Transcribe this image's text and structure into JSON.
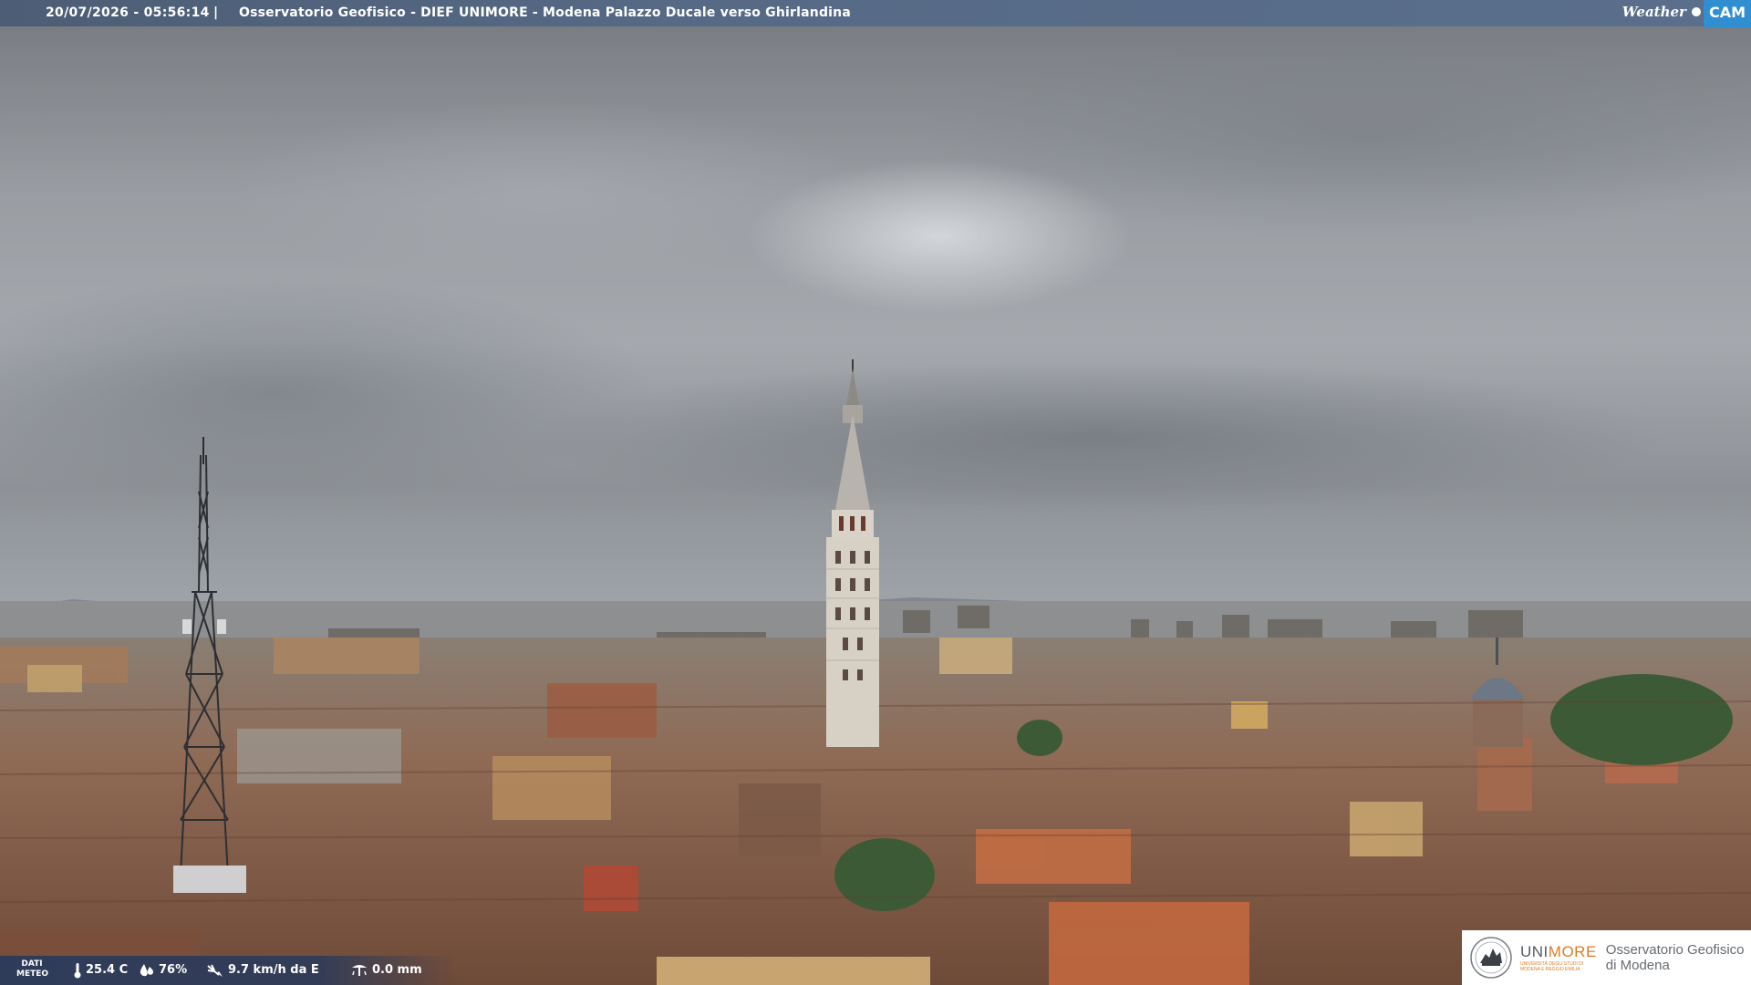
{
  "header": {
    "datetime": "20/07/2026 - 05:56:14",
    "separator": "|",
    "title": "Osservatorio Geofisico - DIEF UNIMORE - Modena Palazzo Ducale verso Ghirlandina",
    "brand_weather": "Weather",
    "brand_cam": "CAM"
  },
  "weather": {
    "section_label_line1": "DATI",
    "section_label_line2": "METEO",
    "temperature": "25.4 C",
    "humidity": "76%",
    "wind": "9.7 km/h da E",
    "rain": "0.0 mm",
    "icons": [
      "thermometer-icon",
      "humidity-drop-icon",
      "wind-icon",
      "rain-gauge-icon"
    ]
  },
  "logo": {
    "uni_part1": "UNI",
    "uni_part2": "MORE",
    "uni_sub_line1": "UNIVERSITÀ DEGLI STUDI DI",
    "uni_sub_line2": "MODENA E REGGIO EMILIA",
    "obs_line1": "Osservatorio Geofisico",
    "obs_line2": "di Modena"
  },
  "colors": {
    "topbar": "#566a86",
    "brand_cam_bg": "#2f8fd0",
    "unimore_orange": "#e07b22",
    "meteo_bg": "#283a5c"
  }
}
